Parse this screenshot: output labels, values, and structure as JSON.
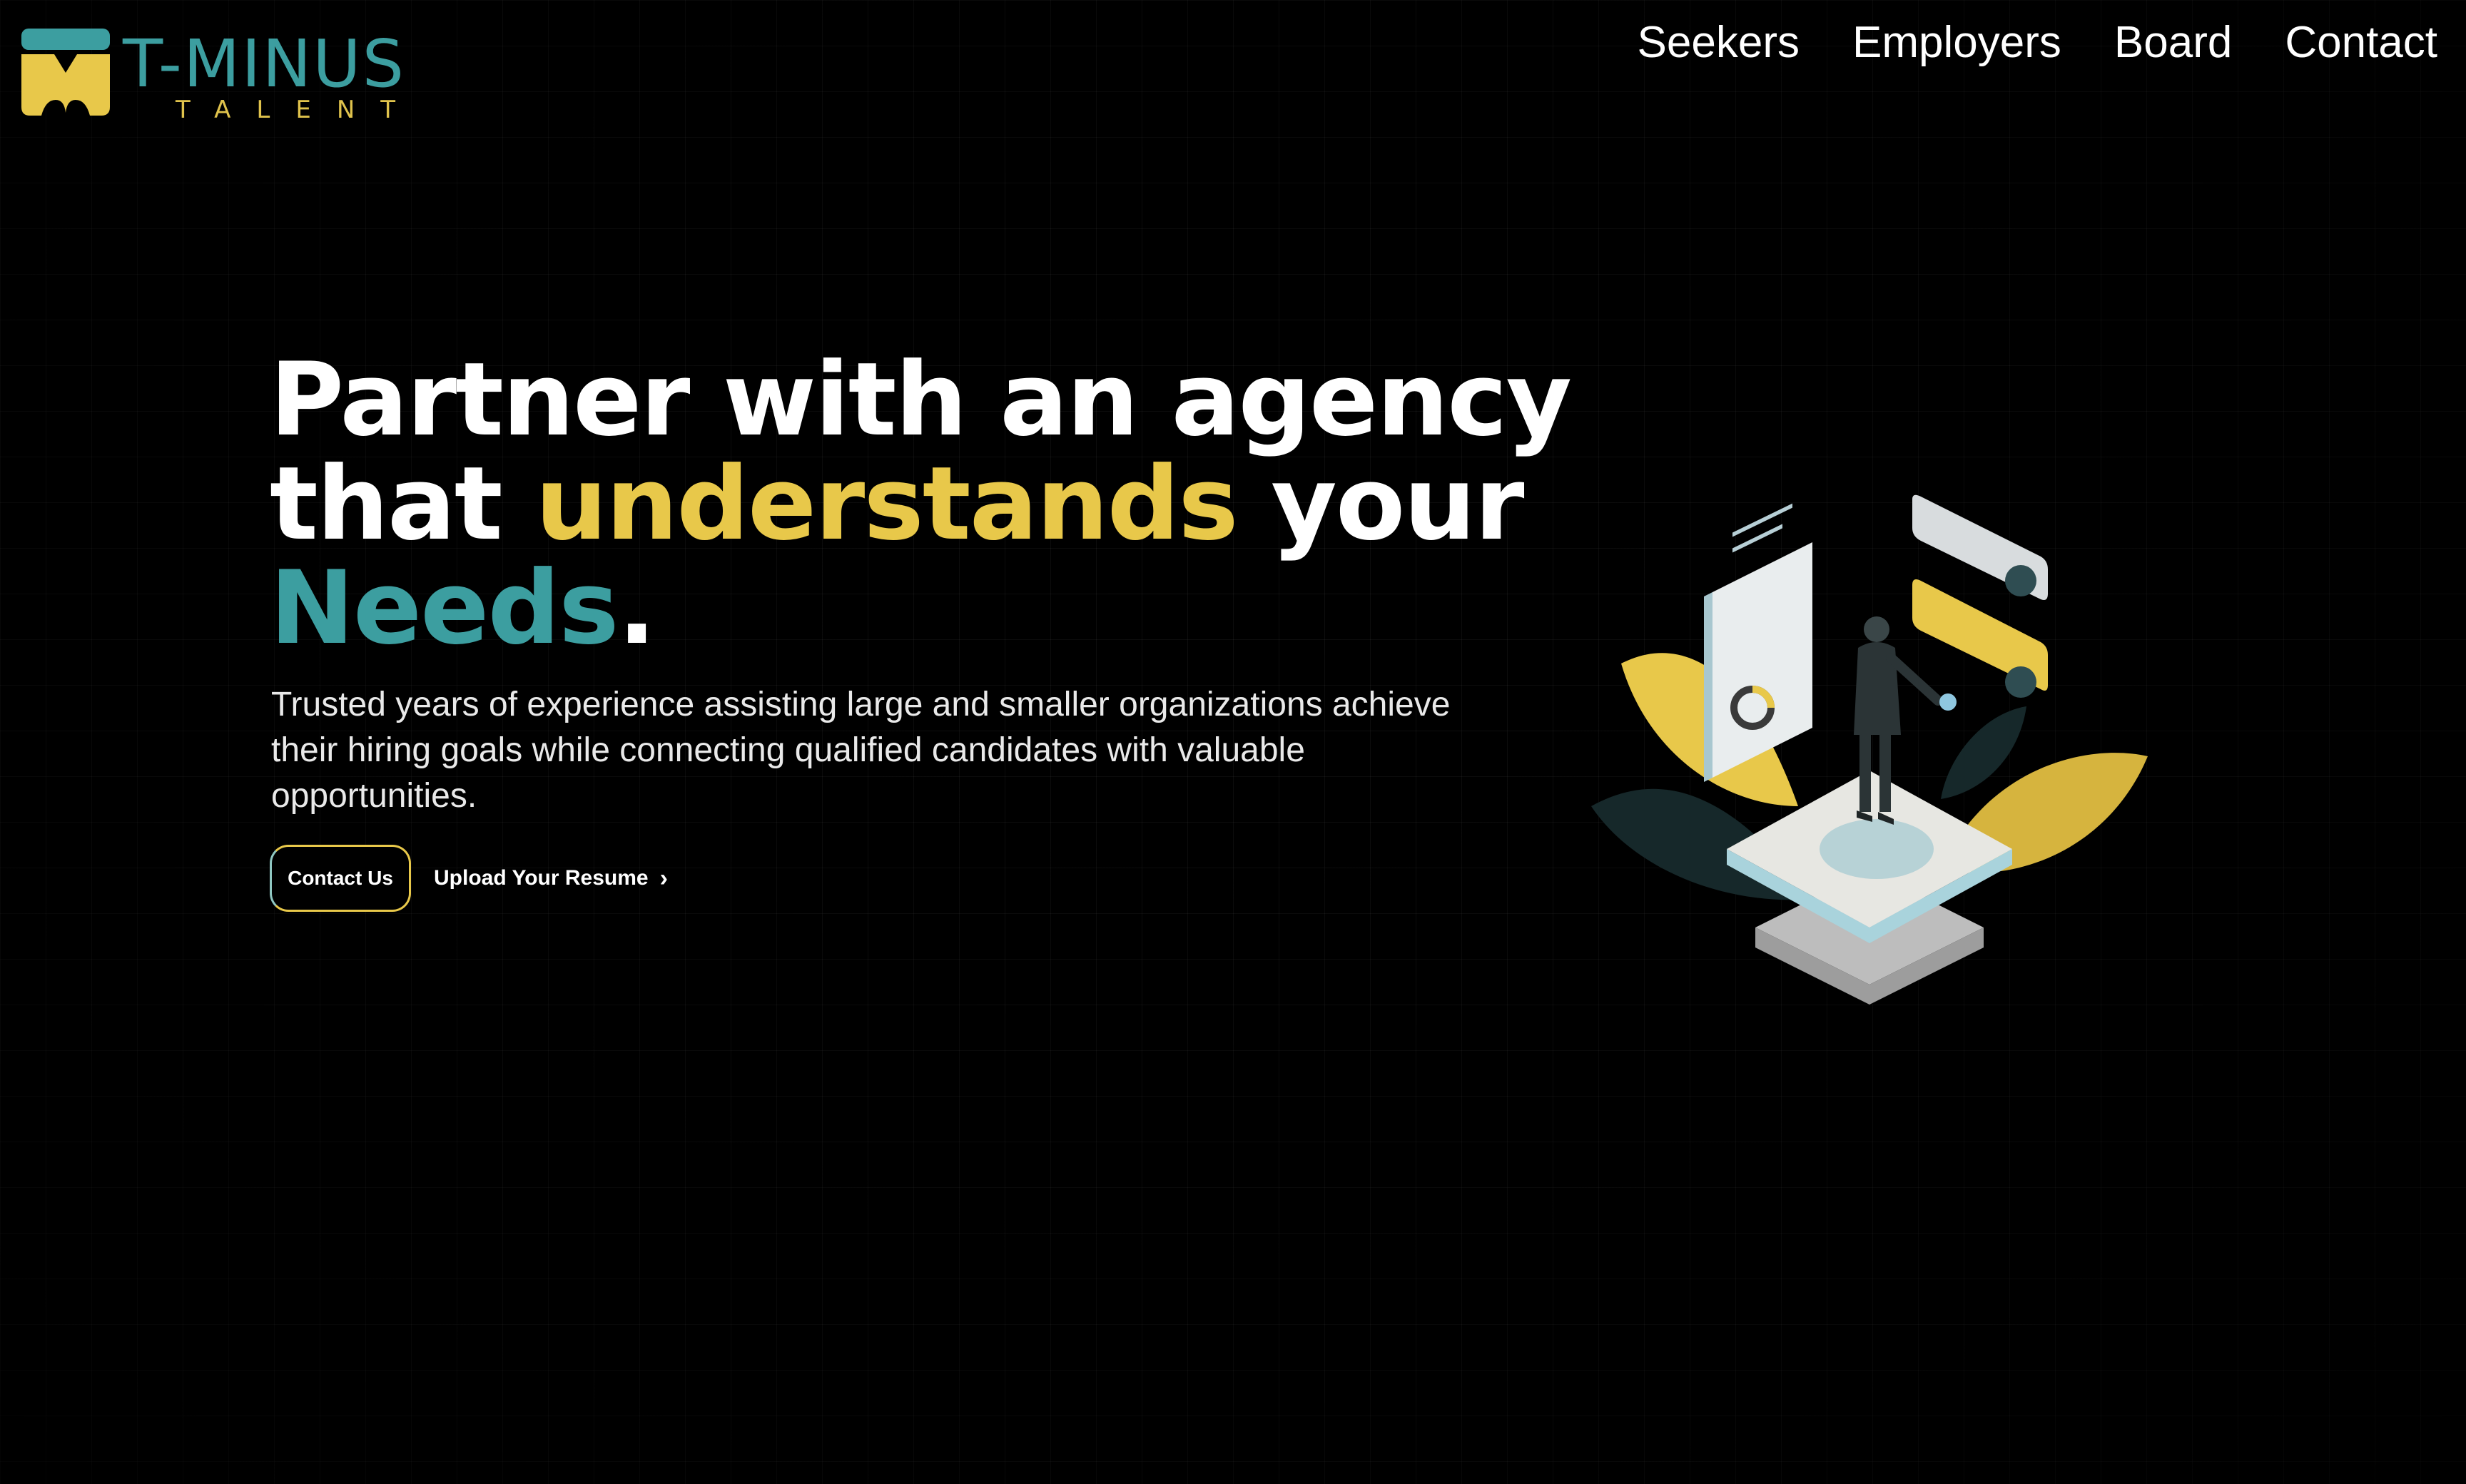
{
  "brand": {
    "name": "T-MINUS",
    "tagline": "TALENT",
    "colors": {
      "teal": "#3c9ea0",
      "yellow": "#e8c84a",
      "background": "#000000"
    }
  },
  "nav": {
    "items": [
      {
        "label": "Seekers"
      },
      {
        "label": "Employers"
      },
      {
        "label": "Board"
      },
      {
        "label": "Contact"
      }
    ]
  },
  "hero": {
    "headline": {
      "line1": "Partner with an agency",
      "line2_start": "that ",
      "line2_highlight": "understands",
      "line2_end": " your",
      "line3_highlight": "Needs",
      "line3_end": "."
    },
    "description": "Trusted years of experience assisting large and smaller organizations achieve their hiring goals while connecting qualified candidates with valuable opportunities.",
    "primary_cta": "Contact Us",
    "secondary_cta": "Upload Your Resume",
    "secondary_cta_icon": "chevron-right-icon"
  },
  "illustration": {
    "icon": "recruiter-isometric-illustration"
  }
}
